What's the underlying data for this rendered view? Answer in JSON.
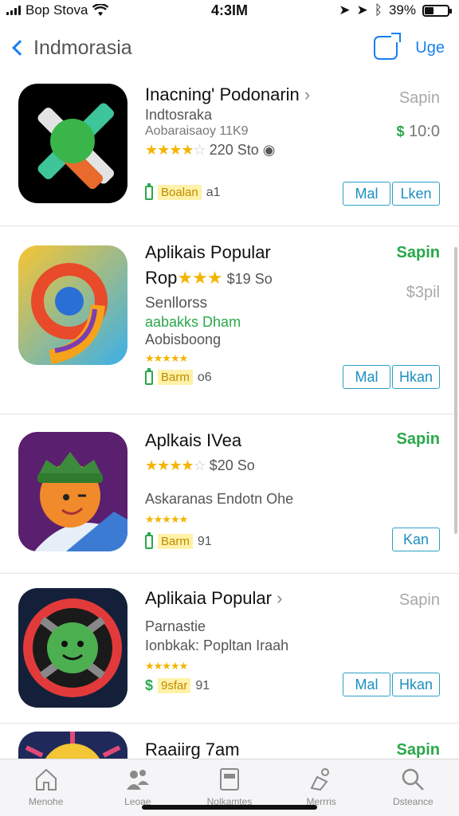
{
  "status": {
    "carrier": "Bop Stova",
    "time": "4:3IM",
    "battery": "39%",
    "battery_level": 0.39
  },
  "nav": {
    "back_label": "Indmorasia",
    "action_label": "Uge"
  },
  "rows": [
    {
      "title": "Inacning' Podonarin",
      "title_suffix": "›",
      "sub1": "Indtosraka",
      "sub2": "Aobaraisaoy 11K9",
      "rating_text": "220 Sto",
      "badge_text": "Boalan",
      "badge_num": "a1",
      "price": "Sapin",
      "price2": "10:0",
      "btn1": "Mal",
      "btn2": "Lken",
      "icon": "x-shape-icon",
      "rating": 4
    },
    {
      "title": "Aplikais Popular",
      "title2": "Rop",
      "price_inline": "$19 So",
      "sub1": "Senllorss",
      "sub2": "aabakks Dham",
      "sub3": "Aobisboong",
      "badge_text": "Barm",
      "badge_num": "o6",
      "price": "Sapin",
      "price2": "$3pil",
      "btn1": "Mal",
      "btn2": "Hkan",
      "icon": "number-nine-icon",
      "rating": 3.5
    },
    {
      "title": "Aplkais IVea",
      "rating_text": "$20 So",
      "sub1": "Askaranas Endotn Ohe",
      "badge_text": "Barm",
      "badge_num": "91",
      "price": "Sapin",
      "btn2": "Kan",
      "icon": "helmet-character-icon",
      "rating": 4.5
    },
    {
      "title": "Aplikaia Popular",
      "title_suffix": "›",
      "sub1": "Parnastie",
      "sub2": "Ionbkak: Popltan Iraah",
      "badge_text": "9sfar",
      "badge_num": "91",
      "price": "Sapin",
      "btn1": "Mal",
      "btn2": "Hkan",
      "icon": "green-virus-icon",
      "rating": 5
    },
    {
      "title": "Raaiirg 7am",
      "price": "Sapin",
      "icon": "sun-creature-icon"
    }
  ],
  "tabs": [
    {
      "label": "Menohe",
      "icon": "home-icon"
    },
    {
      "label": "Leoae",
      "icon": "people-icon"
    },
    {
      "label": "Nolkamtes",
      "icon": "document-icon"
    },
    {
      "label": "Merrris",
      "icon": "pin-icon"
    },
    {
      "label": "Dsteance",
      "icon": "search-icon"
    }
  ]
}
